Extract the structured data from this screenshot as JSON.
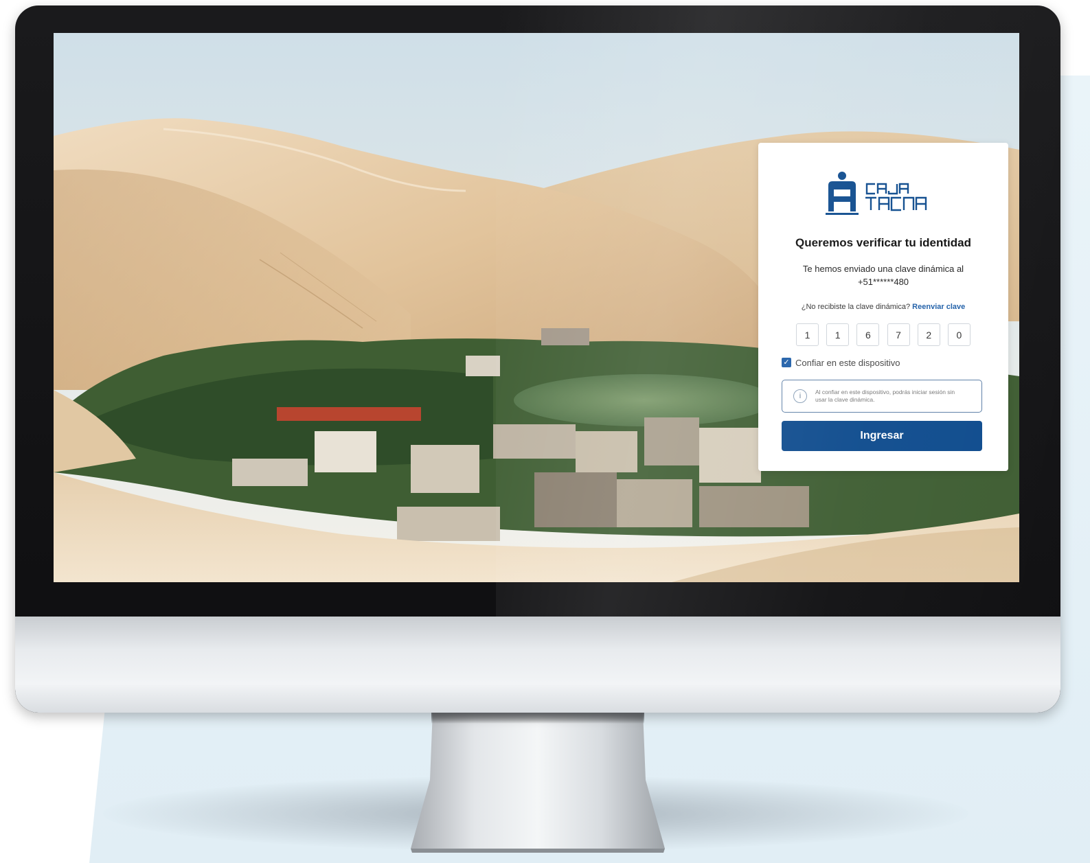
{
  "brand": {
    "name_line1": "CAJA",
    "name_line2": "TACNA",
    "color": "#0f4c8e"
  },
  "verify": {
    "title": "Queremos verificar tu identidad",
    "sent_text": "Te hemos enviado una clave dinámica al",
    "phone": "+51******480",
    "resend_question": "¿No recibiste la clave dinámica?",
    "resend_link": "Reenviar clave"
  },
  "otp": {
    "digits": [
      "1",
      "1",
      "6",
      "7",
      "2",
      "0"
    ]
  },
  "trust": {
    "checked": true,
    "label": "Confiar en este dispositivo"
  },
  "info": {
    "icon": "info-icon",
    "text": "Al confiar en este dispositivo, podrás iniciar sesión sin usar la clave dinámica."
  },
  "submit": {
    "label": "Ingresar"
  },
  "colors": {
    "primary": "#0f4c8e",
    "link": "#1f5fa8",
    "backdrop": "#e4f0f6"
  }
}
